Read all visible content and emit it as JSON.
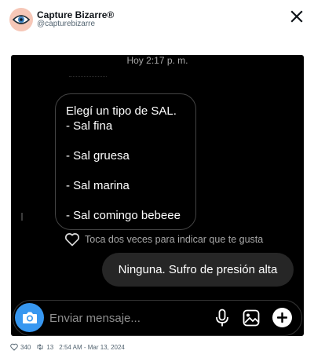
{
  "tweet": {
    "display_name": "Capture Bizarre®",
    "handle": "@capturebizarre",
    "likes": "340",
    "retweets": "13",
    "timestamp": "2:54 AM - Mar 13, 2024"
  },
  "chat": {
    "time_label": "Hoy 2:17 p. m.",
    "received_message": {
      "lines": [
        "Elegí un tipo de SAL.",
        "- Sal fina",
        "",
        "- Sal gruesa",
        "",
        "- Sal marina",
        "",
        "- Sal comingo bebeee"
      ]
    },
    "like_hint": "Toca dos veces para indicar que te gusta",
    "sent_message": "Ninguna. Sufro de presión alta",
    "composer_placeholder": "Enviar mensaje..."
  },
  "colors": {
    "chat_background": "#000000",
    "sent_bubble": "#262626",
    "camera_button": "#3797f0",
    "avatar_bg": "#f6c7b7"
  },
  "icons": {
    "avatar": "eye-icon",
    "x_logo": "x-logo-icon",
    "heart": "heart-icon",
    "camera": "camera-icon",
    "mic": "microphone-icon",
    "gallery": "gallery-icon",
    "plus": "plus-icon",
    "like": "heart-outline-icon",
    "retweet": "retweet-icon"
  }
}
